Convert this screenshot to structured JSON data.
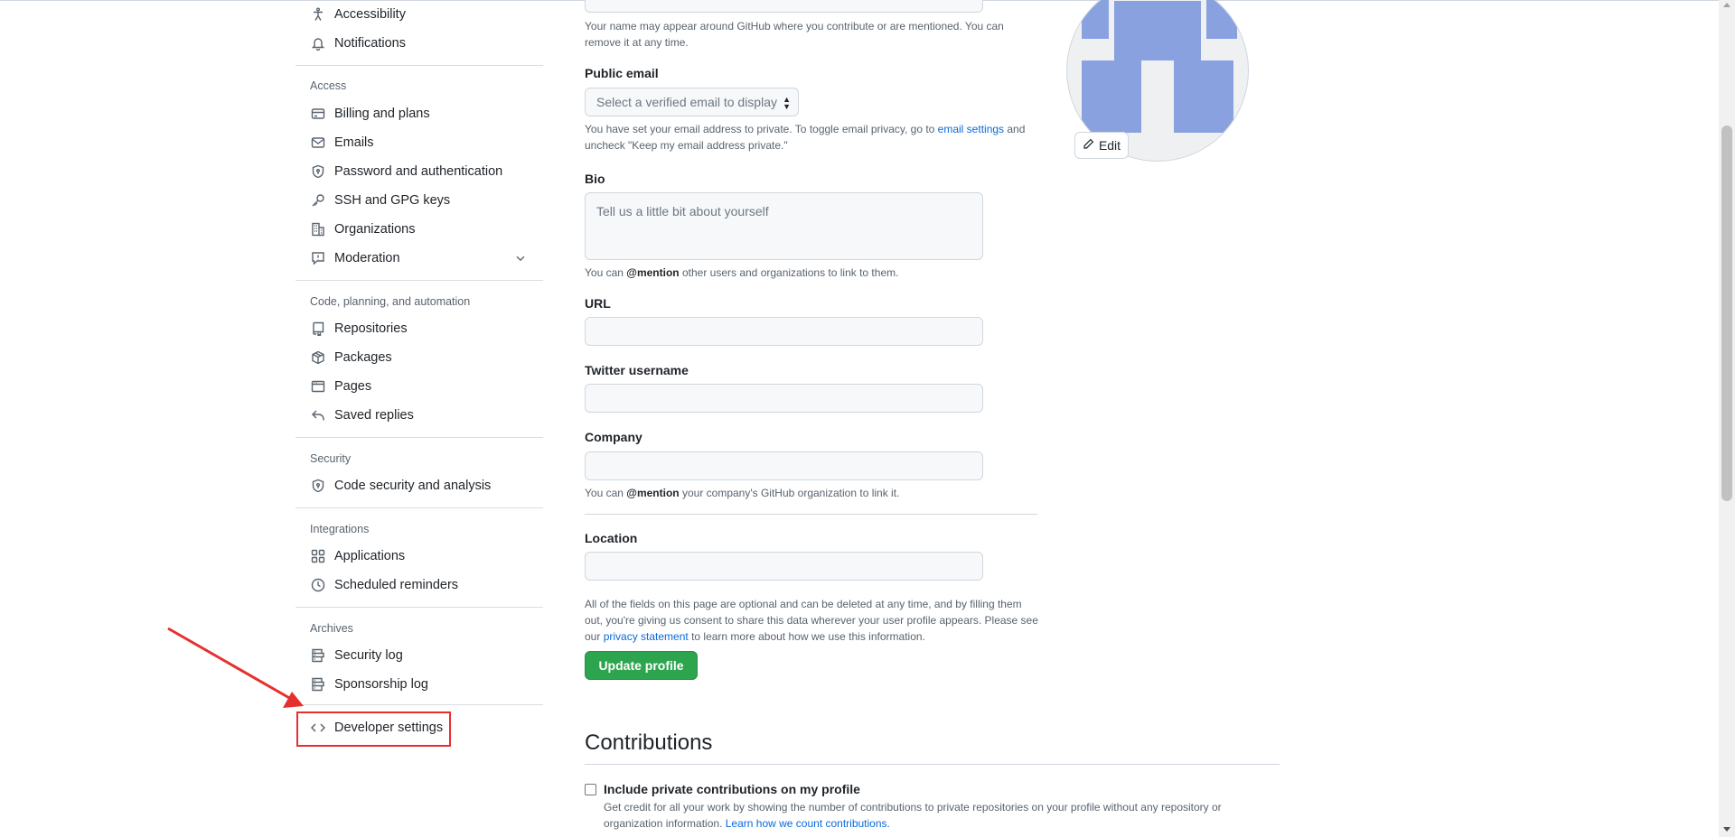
{
  "sidebar": {
    "top_items": [
      {
        "label": "Accessibility",
        "icon": "accessibility-icon"
      },
      {
        "label": "Notifications",
        "icon": "bell-icon"
      }
    ],
    "groups": {
      "access": {
        "header": "Access",
        "items": [
          {
            "label": "Billing and plans",
            "icon": "credit-card-icon"
          },
          {
            "label": "Emails",
            "icon": "mail-icon"
          },
          {
            "label": "Password and authentication",
            "icon": "shield-lock-icon"
          },
          {
            "label": "SSH and GPG keys",
            "icon": "key-icon"
          },
          {
            "label": "Organizations",
            "icon": "organization-icon"
          },
          {
            "label": "Moderation",
            "icon": "report-icon"
          }
        ]
      },
      "code": {
        "header": "Code, planning, and automation",
        "items": [
          {
            "label": "Repositories",
            "icon": "repo-icon"
          },
          {
            "label": "Packages",
            "icon": "package-icon"
          },
          {
            "label": "Pages",
            "icon": "browser-icon"
          },
          {
            "label": "Saved replies",
            "icon": "reply-icon"
          }
        ]
      },
      "security": {
        "header": "Security",
        "items": [
          {
            "label": "Code security and analysis",
            "icon": "shield-lock-icon"
          }
        ]
      },
      "integrations": {
        "header": "Integrations",
        "items": [
          {
            "label": "Applications",
            "icon": "apps-icon"
          },
          {
            "label": "Scheduled reminders",
            "icon": "clock-icon"
          }
        ]
      },
      "archives": {
        "header": "Archives",
        "items": [
          {
            "label": "Security log",
            "icon": "log-icon"
          },
          {
            "label": "Sponsorship log",
            "icon": "log-icon"
          }
        ]
      }
    },
    "developer_settings": {
      "label": "Developer settings",
      "icon": "code-icon"
    }
  },
  "profile_form": {
    "name_help": "Your name may appear around GitHub where you contribute or are mentioned. You can remove it at any time.",
    "public_email": {
      "label": "Public email",
      "selected": "Select a verified email to display",
      "help_prefix": "You have set your email address to private. To toggle email privacy, go to ",
      "help_link": "email settings",
      "help_suffix": " and uncheck \"Keep my email address private.\""
    },
    "bio": {
      "label": "Bio",
      "placeholder": "Tell us a little bit about yourself",
      "help_prefix": "You can ",
      "help_mention": "@mention",
      "help_suffix": " other users and organizations to link to them."
    },
    "url": {
      "label": "URL",
      "value": ""
    },
    "twitter": {
      "label": "Twitter username",
      "value": ""
    },
    "company": {
      "label": "Company",
      "value": "",
      "help_prefix": "You can ",
      "help_mention": "@mention",
      "help_suffix": " your company's GitHub organization to link it."
    },
    "location": {
      "label": "Location",
      "value": ""
    },
    "consent_prefix": "All of the fields on this page are optional and can be deleted at any time, and by filling them out, you're giving us consent to share this data wherever your user profile appears. Please see our ",
    "consent_link": "privacy statement",
    "consent_suffix": " to learn more about how we use this information.",
    "update_button": "Update profile"
  },
  "avatar": {
    "edit_label": "Edit",
    "colors": {
      "background": "#eef0f2",
      "blocks": "#8aa1e0"
    }
  },
  "contributions": {
    "title": "Contributions",
    "checkbox_label": "Include private contributions on my profile",
    "checked": false,
    "help_prefix": "Get credit for all your work by showing the number of contributions to private repositories on your profile without any repository or organization information. ",
    "help_link": "Learn how we count contributions."
  },
  "colors": {
    "accent_link": "#0969da",
    "primary_button": "#2da44e",
    "highlight_box": "#e5302e"
  }
}
